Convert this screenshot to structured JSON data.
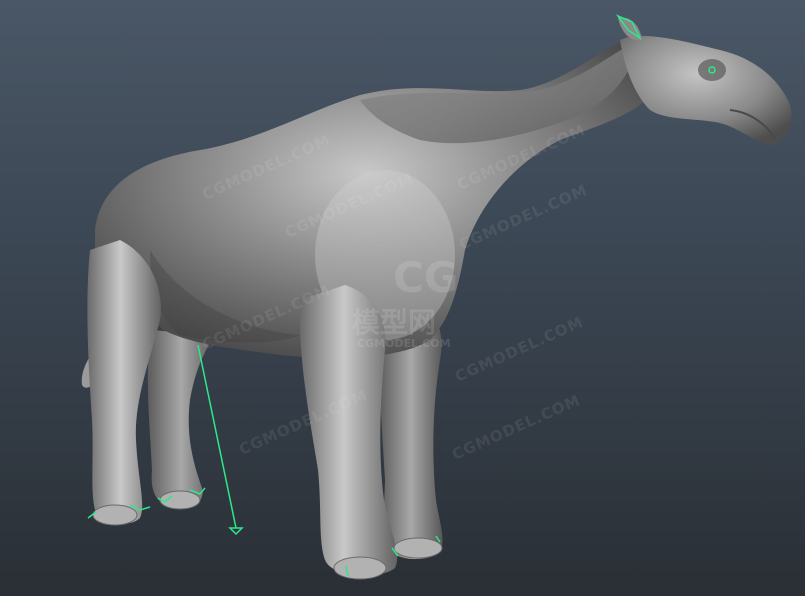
{
  "scene": {
    "background_top": "#4a5766",
    "background_bottom": "#2a2f35",
    "model_color": "#8e8e8e",
    "gizmo_color": "#2ee88a"
  },
  "watermark": {
    "logo_letters": "CG",
    "logo_chinese": "模型网",
    "logo_domain": "CGMODEL.COM",
    "repeated_text": "CGMODEL.COM"
  }
}
